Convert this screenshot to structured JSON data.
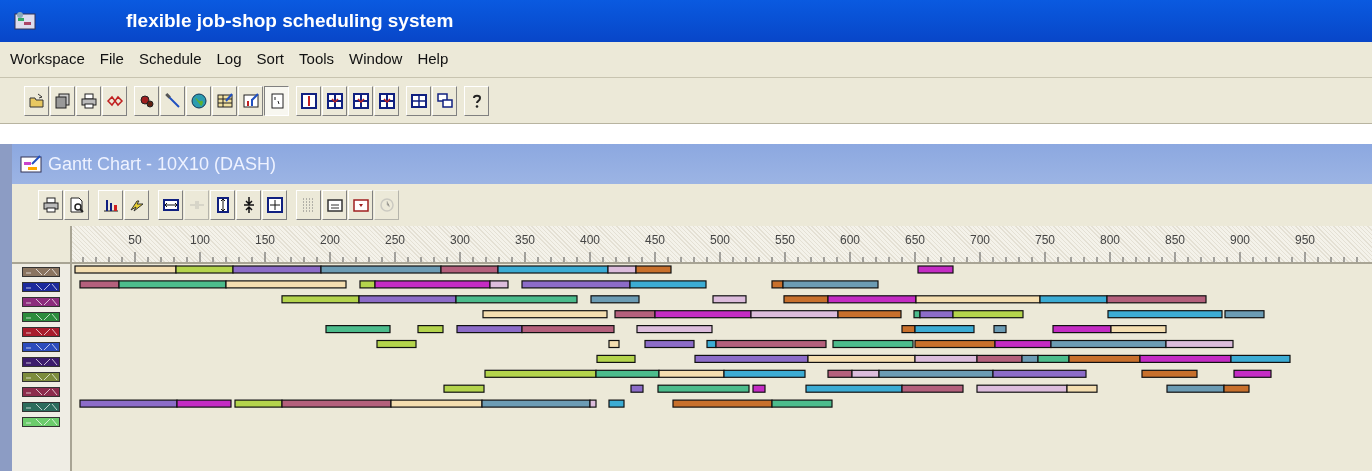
{
  "window": {
    "title": "flexible job-shop scheduling system"
  },
  "menu": [
    {
      "label": "Workspace"
    },
    {
      "label": "File"
    },
    {
      "label": "Schedule"
    },
    {
      "label": "Log"
    },
    {
      "label": "Sort"
    },
    {
      "label": "Tools"
    },
    {
      "label": "Window"
    },
    {
      "label": "Help"
    }
  ],
  "toolbar": [
    [
      {
        "kind": "open",
        "pressed": false
      },
      {
        "kind": "copy",
        "pressed": false
      },
      {
        "kind": "print",
        "pressed": false
      },
      {
        "kind": "network",
        "pressed": false
      }
    ],
    [
      {
        "kind": "gears",
        "pressed": false
      },
      {
        "kind": "hammer",
        "pressed": false
      },
      {
        "kind": "globe",
        "pressed": false
      },
      {
        "kind": "table",
        "pressed": false
      },
      {
        "kind": "chart",
        "pressed": false
      },
      {
        "kind": "note",
        "pressed": true
      }
    ],
    [
      {
        "kind": "win1",
        "pressed": false
      },
      {
        "kind": "win2",
        "pressed": false
      },
      {
        "kind": "win3",
        "pressed": false
      },
      {
        "kind": "win4",
        "pressed": false
      }
    ],
    [
      {
        "kind": "grid",
        "pressed": false
      },
      {
        "kind": "cascade",
        "pressed": false
      }
    ],
    [
      {
        "kind": "help",
        "pressed": false
      }
    ]
  ],
  "child_window": {
    "title": "Gantt Chart - 10X10 (DASH)",
    "toolbar": [
      [
        {
          "kind": "print",
          "disabled": false
        },
        {
          "kind": "preview",
          "disabled": false
        }
      ],
      [
        {
          "kind": "bars",
          "disabled": false
        },
        {
          "kind": "bolt",
          "disabled": false
        }
      ],
      [
        {
          "kind": "fitw",
          "disabled": false
        },
        {
          "kind": "shrink",
          "disabled": true
        },
        {
          "kind": "fith",
          "disabled": false
        },
        {
          "kind": "compress",
          "disabled": false
        },
        {
          "kind": "fitall",
          "disabled": false
        }
      ],
      [
        {
          "kind": "dots",
          "disabled": false
        },
        {
          "kind": "cal",
          "disabled": false
        },
        {
          "kind": "calred",
          "disabled": false
        },
        {
          "kind": "clock",
          "disabled": true
        }
      ]
    ],
    "ruler": [
      "50",
      "100",
      "150",
      "200",
      "250",
      "300",
      "350",
      "400",
      "450",
      "500",
      "550",
      "600",
      "650",
      "700",
      "750",
      "800",
      "850",
      "900",
      "950"
    ],
    "machines": [
      {
        "color": "#8a7460"
      },
      {
        "color": "#1c2a9c"
      },
      {
        "color": "#8c2c7c"
      },
      {
        "color": "#2c8c3c"
      },
      {
        "color": "#a81c2c"
      },
      {
        "color": "#2c4cbc"
      },
      {
        "color": "#3c1c6c"
      },
      {
        "color": "#7c8c3c"
      },
      {
        "color": "#8c2c4c"
      },
      {
        "color": "#2c6c5c"
      },
      {
        "color": "#6ccc6c"
      }
    ]
  }
}
